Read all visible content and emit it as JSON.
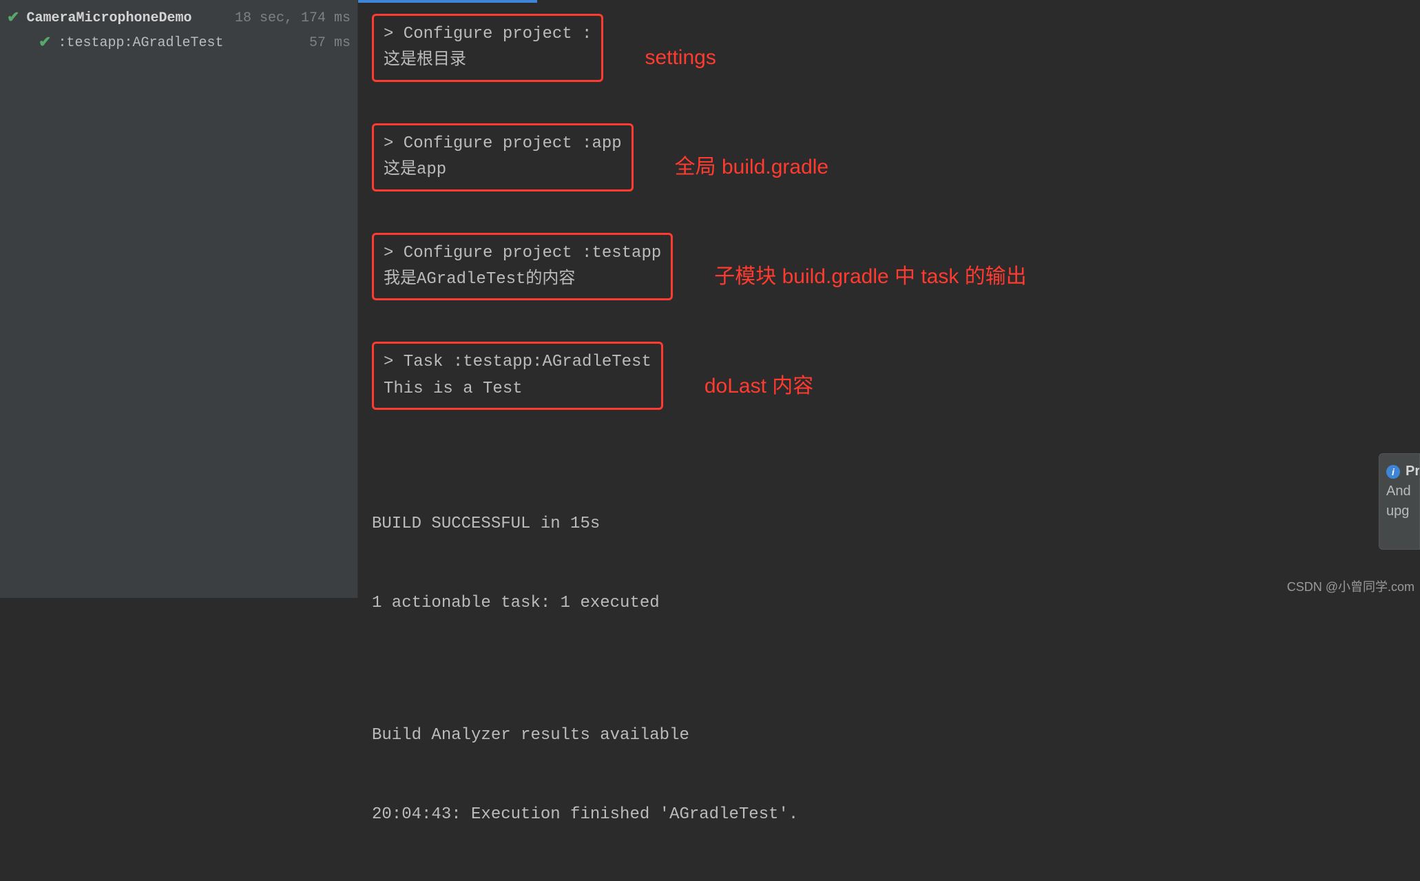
{
  "sidebar": {
    "items": [
      {
        "label": "CameraMicrophoneDemo",
        "time": "18 sec, 174 ms",
        "level": 1,
        "bold": true
      },
      {
        "label": ":testapp:AGradleTest",
        "time": "57 ms",
        "level": 2,
        "bold": false
      }
    ]
  },
  "console": {
    "blocks": [
      {
        "lines": [
          "> Configure project :",
          "这是根目录"
        ],
        "annotation": "settings"
      },
      {
        "lines": [
          "> Configure project :app",
          "这是app"
        ],
        "annotation": "全局 build.gradle"
      },
      {
        "lines": [
          "> Configure project :testapp",
          "我是AGradleTest的内容"
        ],
        "annotation": "子模块 build.gradle 中 task 的输出"
      },
      {
        "lines": [
          "> Task :testapp:AGradleTest",
          "This is a Test"
        ],
        "annotation": "doLast 内容"
      }
    ],
    "footer": [
      "BUILD SUCCESSFUL in 15s",
      "1 actionable task: 1 executed",
      "",
      "Build Analyzer results available",
      "20:04:43: Execution finished 'AGradleTest'."
    ]
  },
  "popup": {
    "title": "Pro",
    "line1": "And",
    "line2": "upg"
  },
  "watermark": "CSDN @小曾同学.com"
}
